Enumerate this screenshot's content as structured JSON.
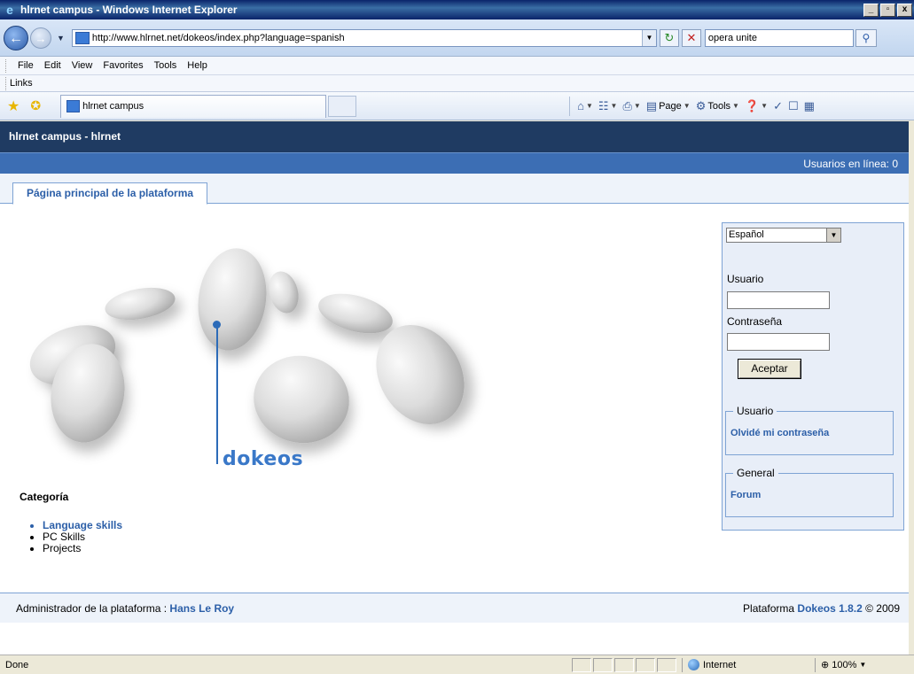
{
  "window": {
    "title": "hlrnet campus - Windows Internet Explorer",
    "controls": {
      "minimize": "_",
      "maximize": "▫",
      "close": "x"
    }
  },
  "address": {
    "url": "http://www.hlrnet.net/dokeos/index.php?language=spanish",
    "search_text": "opera unite"
  },
  "menu": {
    "items": [
      "File",
      "Edit",
      "View",
      "Favorites",
      "Tools",
      "Help"
    ],
    "links_label": "Links"
  },
  "tabbar": {
    "tab_title": "hlrnet campus",
    "commands": {
      "page": "Page",
      "tools": "Tools"
    }
  },
  "site": {
    "header_title": "hlrnet campus - hlrnet",
    "online_users": "Usuarios en línea:  0",
    "main_tab": "Página principal de la plataforma",
    "logo_text": "dokeos",
    "category_title": "Categoría",
    "categories": [
      {
        "label": "Language skills",
        "is_link": true
      },
      {
        "label": "PC Skills",
        "is_link": false
      },
      {
        "label": "Projects",
        "is_link": false
      }
    ]
  },
  "login": {
    "language_value": "Español",
    "username_label": "Usuario",
    "password_label": "Contraseña",
    "submit_label": "Aceptar",
    "user_section_title": "Usuario",
    "forgot_password": "Olvidé mi contraseña",
    "general_section_title": "General",
    "forum_link": "Forum"
  },
  "footer": {
    "admin_prefix": "Administrador de la plataforma : ",
    "admin_name": "Hans Le Roy",
    "platform_prefix": "Plataforma ",
    "platform_link": "Dokeos 1.8.2",
    "platform_suffix": " © 2009"
  },
  "status": {
    "text": "Done",
    "zone": "Internet",
    "zoom": "100%"
  },
  "colors": {
    "header_dark": "#1f3b62",
    "header_band": "#3c6eb4",
    "link_blue": "#2c5fa8",
    "panel_bg": "#e8eef8"
  }
}
